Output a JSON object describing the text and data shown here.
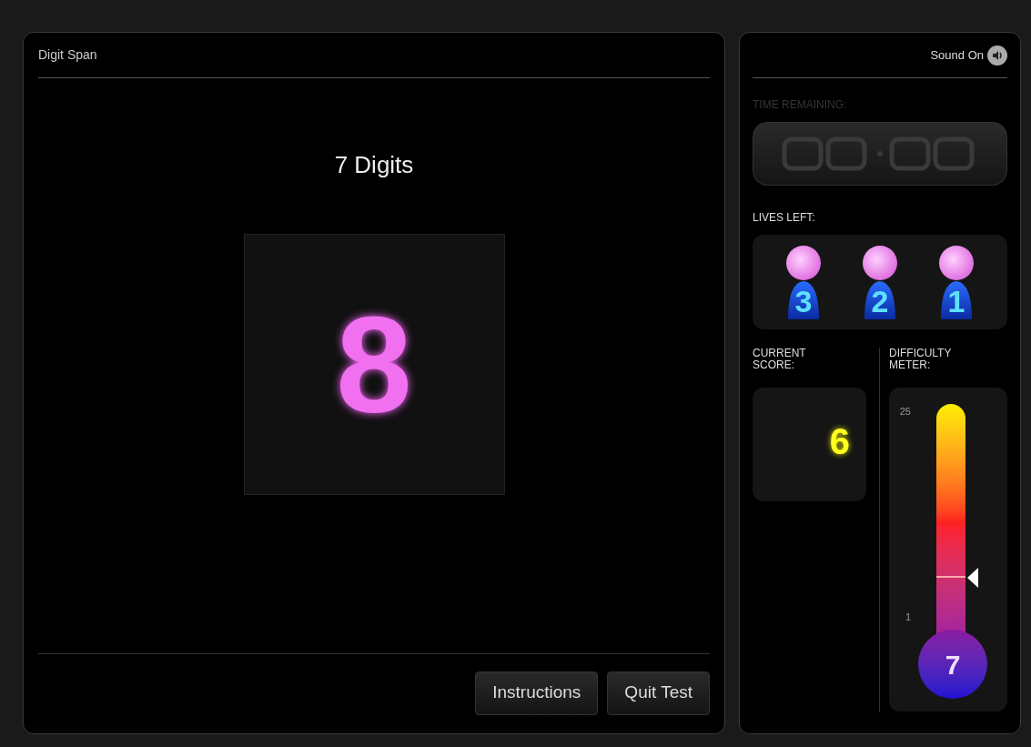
{
  "panel": {
    "title": "Digit Span",
    "heading": "7 Digits",
    "digit": "8"
  },
  "buttons": [
    "Instructions",
    "Quit Test"
  ],
  "sidebar": {
    "sound": {
      "label": "Sound On",
      "on": true
    },
    "time": {
      "label": "TIME REMAINING:",
      "disabled": true
    },
    "lives_label": "LIVES LEFT:",
    "lives": [
      {
        "number": "3"
      },
      {
        "number": "2"
      },
      {
        "number": "1"
      }
    ],
    "score_label": "CURRENT SCORE:",
    "score": "6",
    "difficulty_label": "DIFFICULTY METER:",
    "difficulty": {
      "max": "25",
      "min": "1",
      "value": "7",
      "level": 0.25
    }
  }
}
